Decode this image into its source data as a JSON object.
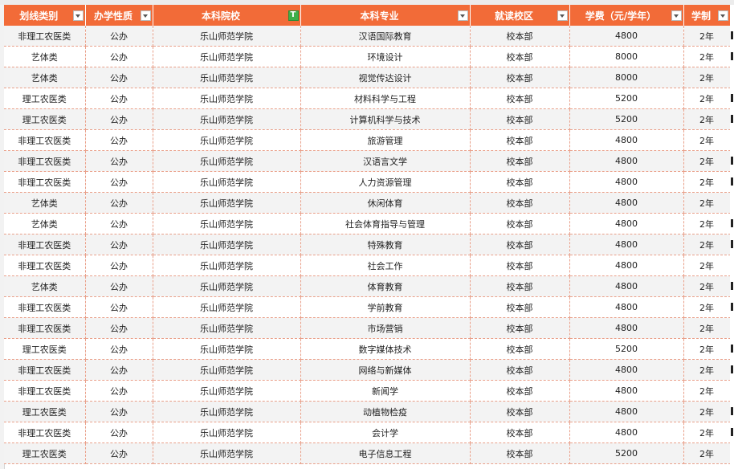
{
  "headers": [
    "划线类别",
    "办学性质",
    "本科院校",
    "本科专业",
    "就读校区",
    "学费（元/学年）",
    "学制"
  ],
  "rows": [
    [
      "非理工农医类",
      "公办",
      "乐山师范学院",
      "汉语国际教育",
      "校本部",
      "4800",
      "2年"
    ],
    [
      "艺体类",
      "公办",
      "乐山师范学院",
      "环境设计",
      "校本部",
      "8000",
      "2年"
    ],
    [
      "艺体类",
      "公办",
      "乐山师范学院",
      "视觉传达设计",
      "校本部",
      "8000",
      "2年"
    ],
    [
      "理工农医类",
      "公办",
      "乐山师范学院",
      "材料科学与工程",
      "校本部",
      "5200",
      "2年"
    ],
    [
      "理工农医类",
      "公办",
      "乐山师范学院",
      "计算机科学与技术",
      "校本部",
      "5200",
      "2年"
    ],
    [
      "非理工农医类",
      "公办",
      "乐山师范学院",
      "旅游管理",
      "校本部",
      "4800",
      "2年"
    ],
    [
      "非理工农医类",
      "公办",
      "乐山师范学院",
      "汉语言文学",
      "校本部",
      "4800",
      "2年"
    ],
    [
      "非理工农医类",
      "公办",
      "乐山师范学院",
      "人力资源管理",
      "校本部",
      "4800",
      "2年"
    ],
    [
      "艺体类",
      "公办",
      "乐山师范学院",
      "休闲体育",
      "校本部",
      "4800",
      "2年"
    ],
    [
      "艺体类",
      "公办",
      "乐山师范学院",
      "社会体育指导与管理",
      "校本部",
      "4800",
      "2年"
    ],
    [
      "非理工农医类",
      "公办",
      "乐山师范学院",
      "特殊教育",
      "校本部",
      "4800",
      "2年"
    ],
    [
      "非理工农医类",
      "公办",
      "乐山师范学院",
      "社会工作",
      "校本部",
      "4800",
      "2年"
    ],
    [
      "艺体类",
      "公办",
      "乐山师范学院",
      "体育教育",
      "校本部",
      "4800",
      "2年"
    ],
    [
      "非理工农医类",
      "公办",
      "乐山师范学院",
      "学前教育",
      "校本部",
      "4800",
      "2年"
    ],
    [
      "非理工农医类",
      "公办",
      "乐山师范学院",
      "市场营销",
      "校本部",
      "4800",
      "2年"
    ],
    [
      "理工农医类",
      "公办",
      "乐山师范学院",
      "数字媒体技术",
      "校本部",
      "5200",
      "2年"
    ],
    [
      "非理工农医类",
      "公办",
      "乐山师范学院",
      "网络与新媒体",
      "校本部",
      "4800",
      "2年"
    ],
    [
      "非理工农医类",
      "公办",
      "乐山师范学院",
      "新闻学",
      "校本部",
      "4800",
      "2年"
    ],
    [
      "理工农医类",
      "公办",
      "乐山师范学院",
      "动植物检疫",
      "校本部",
      "4800",
      "2年"
    ],
    [
      "非理工农医类",
      "公办",
      "乐山师范学院",
      "会计学",
      "校本部",
      "4800",
      "2年"
    ],
    [
      "理工农医类",
      "公办",
      "乐山师范学院",
      "电子信息工程",
      "校本部",
      "5200",
      "2年"
    ]
  ],
  "colors": {
    "header_bg": "#f26b38",
    "header_text": "#ffffff",
    "row_alt": "#f3f3f3",
    "grid_line": "#e9a08a",
    "filter_active": "#3fae49"
  }
}
